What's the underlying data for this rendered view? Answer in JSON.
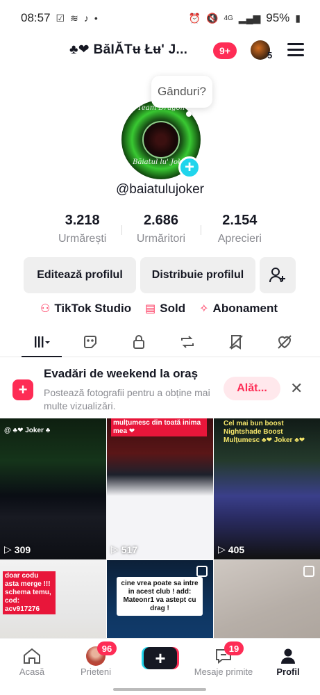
{
  "status_bar": {
    "time": "08:57",
    "left_icons": [
      "checkbox-icon",
      "signal-wave-icon",
      "tiktok-icon",
      "dot-icon"
    ],
    "right_icons": [
      "alarm-icon",
      "mute-icon",
      "wifi-icon",
      "signal-icon"
    ],
    "network": "4G",
    "battery": "95%"
  },
  "header": {
    "name": "♣❤ BăIĂTʉ Łʉ' J...",
    "notif_badge": "9+",
    "account_count": "5"
  },
  "profile": {
    "thought_prompt": "Gânduri?",
    "avatar_text_top": "Team Dragon",
    "avatar_text_bottom": "Băiatul lu' Joker",
    "username": "@baiatulujoker",
    "stats": [
      {
        "value": "3.218",
        "label": "Urmărești"
      },
      {
        "value": "2.686",
        "label": "Urmăritori"
      },
      {
        "value": "2.154",
        "label": "Aprecieri"
      }
    ],
    "edit_button": "Editează profilul",
    "share_button": "Distribuie profilul",
    "quick_links": [
      {
        "label": "TikTok Studio",
        "icon": "studio-icon"
      },
      {
        "label": "Sold",
        "icon": "wallet-icon"
      },
      {
        "label": "Abonament",
        "icon": "subscription-icon"
      }
    ]
  },
  "tabs": [
    "videos-grid-icon",
    "stickers-icon",
    "lock-icon",
    "repost-icon",
    "saved-icon",
    "liked-icon"
  ],
  "promo": {
    "title": "Evadări de weekend la oraș",
    "description": "Postează fotografii pentru a obține mai multe vizualizări.",
    "button": "Alăt..."
  },
  "videos": [
    {
      "views": "309",
      "caption": "@ ♣❤ Joker ♣"
    },
    {
      "views": "517",
      "caption": "mulțumesc din toată inima mea ❤"
    },
    {
      "views": "405",
      "caption": "Cel mai bun boost Nightshade Boost Mulțumesc ♣❤ Joker ♣❤"
    },
    {
      "views": "",
      "caption": "doar codu asta merge !!! schema temu, cod: acv917276"
    },
    {
      "views": "",
      "caption": "cine vrea poate sa intre in acest club ! add: Mateonr1 va astept cu drag !"
    },
    {
      "views": "",
      "caption": ""
    }
  ],
  "bottom_nav": {
    "home": "Acasă",
    "friends": "Prieteni",
    "friends_badge": "96",
    "inbox": "Mesaje primite",
    "inbox_badge": "19",
    "profile": "Profil"
  }
}
